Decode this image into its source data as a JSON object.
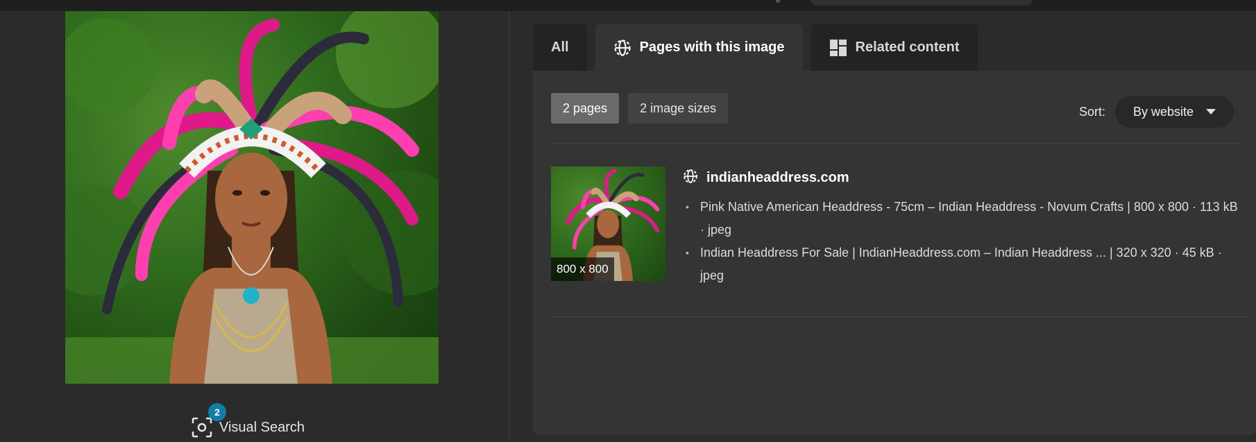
{
  "visual_search": {
    "label": "Visual Search",
    "badge_count": "2"
  },
  "tabs": [
    {
      "label": "All",
      "icon": null,
      "active": false
    },
    {
      "label": "Pages with this image",
      "icon": "globe-icon",
      "active": true
    },
    {
      "label": "Related content",
      "icon": "grid-icon",
      "active": false
    }
  ],
  "filters": {
    "pages": "2 pages",
    "sizes": "2 image sizes"
  },
  "sort": {
    "label": "Sort:",
    "value": "By website"
  },
  "result": {
    "thumb_size": "800 x 800",
    "site": "indianheaddress.com",
    "pages": [
      "Pink Native American Headdress - 75cm – Indian Headdress - Novum Crafts | 800 x 800 · 113 kB · jpeg",
      "Indian Headdress For Sale | IndianHeaddress.com – Indian Headdress ... | 320 x 320 · 45 kB · jpeg"
    ]
  },
  "colors": {
    "background": "#2b2b2b",
    "panel": "#343434",
    "tab_inactive": "#232323",
    "badge": "#0f7fa7",
    "chip_selected": "#6a6a6a"
  }
}
